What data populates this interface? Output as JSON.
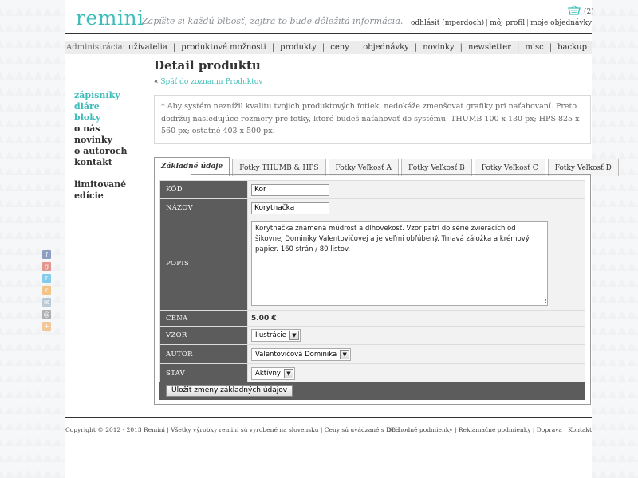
{
  "header": {
    "logo": "remini",
    "tagline": "Zapíšte si každú blbosť, zajtra to bude dôležitá informácia.",
    "cart_count": "(2)",
    "user_links": [
      "odhlásiť (mperdoch)",
      "môj profil",
      "moje objednávky"
    ]
  },
  "nav": {
    "admin_label": "Administrácia:",
    "items": [
      "užívatelia",
      "produktové možnosti",
      "produkty",
      "ceny",
      "objednávky",
      "novinky",
      "newsletter",
      "misc",
      "backup"
    ]
  },
  "sidebar": {
    "categories": [
      "zápisníky",
      "diáre",
      "bloky"
    ],
    "links": [
      "o nás",
      "novinky",
      "o autoroch",
      "kontakt"
    ],
    "extra": [
      "limitované",
      "edície"
    ]
  },
  "social": [
    "facebook-icon",
    "googleplus-icon",
    "twitter-icon",
    "rss-icon",
    "email-icon",
    "mail-icon",
    "share-icon"
  ],
  "colors": {
    "accent": "#3dbdb8",
    "label_bg": "#5c5c5c"
  },
  "main": {
    "title": "Detail produktu",
    "back_prefix": "«",
    "back_link": "Späť do zoznamu Produktov",
    "note": "* Aby systém neznížil kvalitu tvojich produktových fotiek, nedokáže zmenšovať grafiky pri naťahovaní. Preto dodržuj nasledujúce rozmery pre fotky, ktoré budeš naťahovať do systému: THUMB 100 x 130 px; HPS 825 x 560 px; ostatné 403 x 500 px.",
    "tabs": [
      "Základné údaje",
      "Fotky THUMB & HPS",
      "Fotky Veľkosť A",
      "Fotky Veľkosť B",
      "Fotky Veľkosť C",
      "Fotky Veľkosť D"
    ]
  },
  "form": {
    "kod_label": "KÓD",
    "kod_value": "Kor",
    "nazov_label": "NÁZOV",
    "nazov_value": "Korytnačka",
    "popis_label": "POPIS",
    "popis_value": "Korytnačka znamená múdrosť a dlhovekosť. Vzor patrí do série zvieracích od šikovnej Dominiky Valentovičovej a je veľmi obľúbený. Trnavá záložka a krémový papier. 160 strán / 80 listov.",
    "cena_label": "CENA",
    "cena_value": "5.00 €",
    "vzor_label": "VZOR",
    "vzor_value": "Ilustrácie",
    "autor_label": "AUTOR",
    "autor_value": "Valentovičová Dominika",
    "stav_label": "STAV",
    "stav_value": "Aktívny",
    "save_button": "Uložiť zmeny základných údajov"
  },
  "footer": {
    "left": "Copyright © 2012 - 2013 Remini | Všetky výrobky remini sú vyrobené na slovensku | Ceny sú uvádzané s DPH",
    "links": [
      "Obchodné podmienky",
      "Reklamačné podmienky",
      "Doprava",
      "Kontakt"
    ]
  }
}
